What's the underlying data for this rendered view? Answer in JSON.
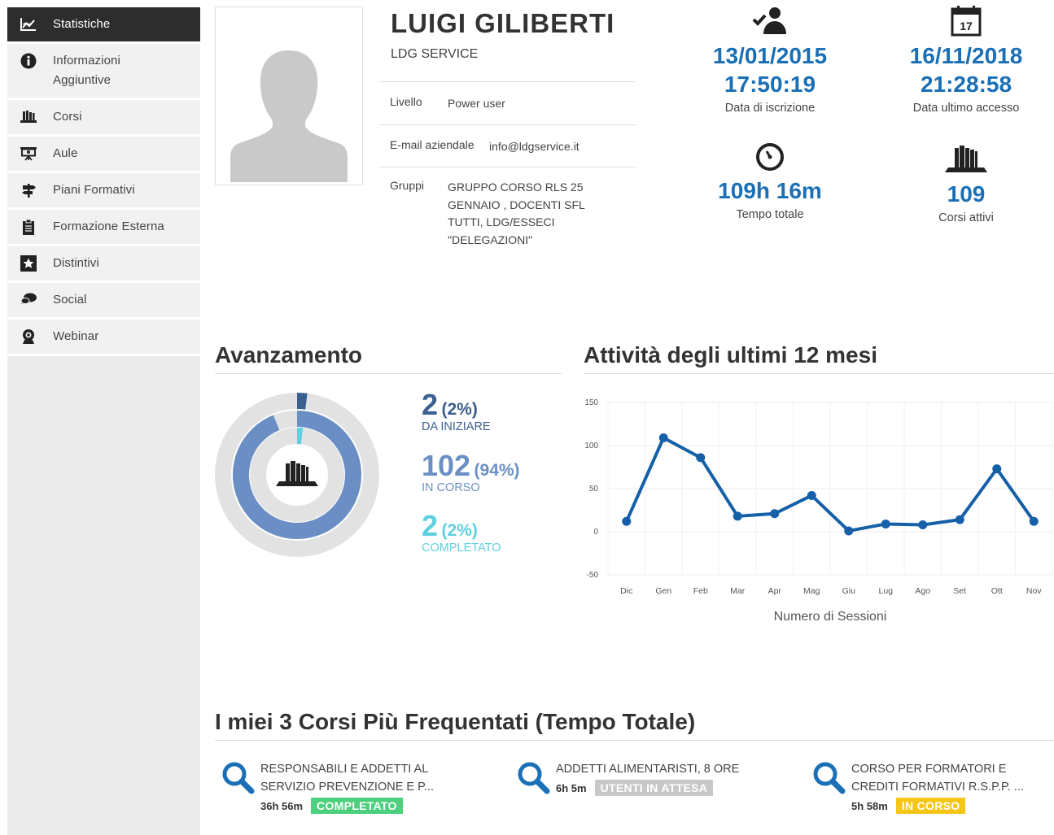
{
  "sidebar": {
    "items": [
      {
        "label": "Statistiche",
        "icon": "chart-icon"
      },
      {
        "label": "Informazioni Aggiuntive",
        "icon": "info-icon"
      },
      {
        "label": "Corsi",
        "icon": "courses-icon"
      },
      {
        "label": "Aule",
        "icon": "classroom-icon"
      },
      {
        "label": "Piani Formativi",
        "icon": "signpost-icon"
      },
      {
        "label": "Formazione Esterna",
        "icon": "clipboard-icon"
      },
      {
        "label": "Distintivi",
        "icon": "star-badge-icon"
      },
      {
        "label": "Social",
        "icon": "chat-bubbles-icon"
      },
      {
        "label": "Webinar",
        "icon": "webcam-icon"
      }
    ]
  },
  "profile": {
    "name": "LUIGI GILIBERTI",
    "company": "LDG SERVICE",
    "level_label": "Livello",
    "level_value": "Power user",
    "email_label": "E-mail aziendale",
    "email_value": "info@ldgservice.it",
    "groups_label": "Gruppi",
    "groups_value": "GRUPPO CORSO RLS 25 GENNAIO , DOCENTI SFL TUTTI, LDG/ESSECI \"DELEGAZIONI\""
  },
  "stats": {
    "registration": {
      "date": "13/01/2015",
      "time": "17:50:19",
      "label": "Data di iscrizione"
    },
    "last_access": {
      "date": "16/11/2018",
      "time": "21:28:58",
      "label": "Data ultimo accesso"
    },
    "total_time": {
      "value": "109h 16m",
      "label": "Tempo totale"
    },
    "active_courses": {
      "value": "109",
      "label": "Corsi attivi"
    }
  },
  "progress": {
    "title": "Avanzamento",
    "items": [
      {
        "count": "2",
        "pct": "(2%)",
        "label": "DA INIZIARE",
        "color": "#3b5f8f",
        "fraction": 0.02
      },
      {
        "count": "102",
        "pct": "(94%)",
        "label": "IN CORSO",
        "color": "#6b8fc4",
        "fraction": 0.94
      },
      {
        "count": "2",
        "pct": "(2%)",
        "label": "COMPLETATO",
        "color": "#5fd0e0",
        "fraction": 0.02
      }
    ]
  },
  "activity": {
    "title": "Attività degli ultimi 12 mesi"
  },
  "chart_data": {
    "type": "line",
    "categories": [
      "Dic",
      "Gen",
      "Feb",
      "Mar",
      "Apr",
      "Mag",
      "Giu",
      "Lug",
      "Ago",
      "Set",
      "Ott",
      "Nov"
    ],
    "series": [
      {
        "name": "",
        "values": [
          12,
          109,
          86,
          18,
          21,
          42,
          1,
          9,
          8,
          14,
          73,
          12
        ],
        "color": "#1560a8"
      }
    ],
    "xlabel": "Numero di Sessioni",
    "ylabel": "",
    "ylim": [
      -50,
      150
    ],
    "yticks": [
      "150",
      "100",
      "50",
      "0",
      "-50"
    ],
    "grid": true
  },
  "courses": {
    "title": "I miei 3 Corsi Più Frequentati (Tempo Totale)",
    "items": [
      {
        "title": "RESPONSABILI E ADDETTI AL SERVIZIO PREVENZIONE E P...",
        "time": "36h 56m",
        "status": "COMPLETATO",
        "status_color": "#4cd07d"
      },
      {
        "title": "ADDETTI ALIMENTARISTI, 8 ORE",
        "time": "6h 5m",
        "status": "UTENTI IN ATTESA",
        "status_color": "#c8c8c8"
      },
      {
        "title": "CORSO PER FORMATORI E CREDITI FORMATIVI R.S.P.P. ...",
        "time": "5h 58m",
        "status": "IN CORSO",
        "status_color": "#f5c518"
      }
    ]
  }
}
